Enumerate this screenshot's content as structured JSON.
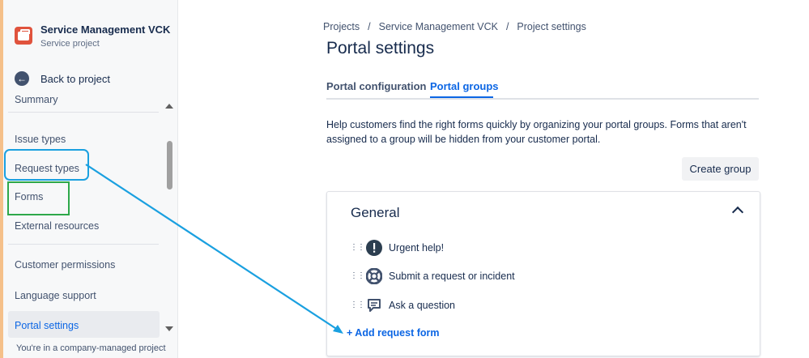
{
  "colors": {
    "accent": "#0c66e4",
    "highlight_blue": "#1aa0e0",
    "highlight_green": "#2ea84a",
    "project_icon": "#e0533d"
  },
  "sidebar": {
    "project_name": "Service Management VCK",
    "project_type": "Service project",
    "back_label": "Back to project",
    "items": {
      "summary": "Summary",
      "issue_types": "Issue types",
      "request_types": "Request types",
      "forms": "Forms",
      "external_resources": "External resources",
      "customer_permissions": "Customer permissions",
      "language_support": "Language support",
      "portal_settings": "Portal settings"
    },
    "footer_note": "You're in a company-managed project"
  },
  "breadcrumb": [
    "Projects",
    "Service Management VCK",
    "Project settings"
  ],
  "page_title": "Portal settings",
  "tabs": {
    "portal_configuration": "Portal configuration",
    "portal_groups": "Portal groups"
  },
  "description": "Help customers find the right forms quickly by organizing your portal groups. Forms that aren't assigned to a group will be hidden from your customer portal.",
  "create_group_label": "Create group",
  "group": {
    "title": "General",
    "forms": [
      {
        "label": "Urgent help!",
        "icon": "exclamation-icon"
      },
      {
        "label": "Submit a request or incident",
        "icon": "lifebuoy-icon"
      },
      {
        "label": "Ask a question",
        "icon": "chat-icon"
      }
    ],
    "add_label": "+ Add request form"
  }
}
